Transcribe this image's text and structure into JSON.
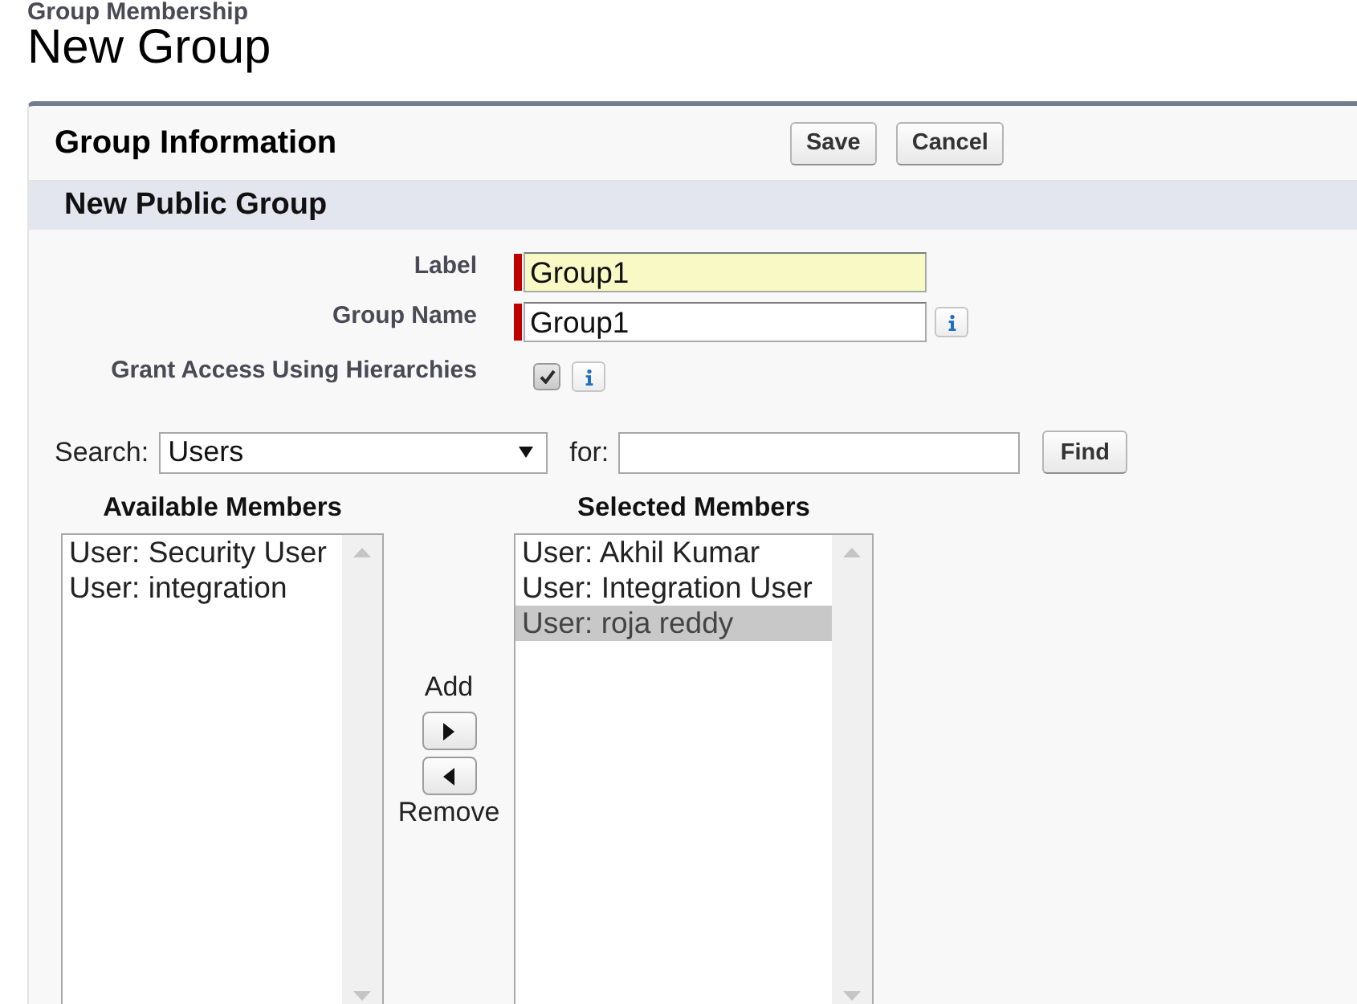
{
  "breadcrumb": "Group Membership",
  "title": "New Group",
  "panel": {
    "title": "Group Information",
    "buttons": [
      "Save",
      "Cancel"
    ]
  },
  "section": {
    "title": "New Public Group"
  },
  "fields": [
    {
      "kind": "text",
      "label": "Label",
      "value": "Group1",
      "required": true,
      "highlighted": true,
      "info": false
    },
    {
      "kind": "text",
      "label": "Group Name",
      "value": "Group1",
      "required": true,
      "highlighted": false,
      "info": true
    },
    {
      "kind": "checkbox",
      "label": "Grant Access Using Hierarchies",
      "checked": true,
      "required": false,
      "info": true
    }
  ],
  "search": {
    "label": "Search:",
    "scope": "Users",
    "for_label": "for:",
    "button": "Find"
  },
  "available": {
    "title": "Available Members",
    "items": [
      {
        "label": "User: Security User",
        "selected": false
      },
      {
        "label": "User: integration",
        "selected": false
      }
    ]
  },
  "transfer": {
    "add_label": "Add",
    "remove_label": "Remove"
  },
  "selected": {
    "title": "Selected Members",
    "items": [
      {
        "label": "User: Akhil Kumar",
        "selected": false
      },
      {
        "label": "User: Integration User",
        "selected": false
      },
      {
        "label": "User: roja reddy",
        "selected": true
      }
    ]
  }
}
